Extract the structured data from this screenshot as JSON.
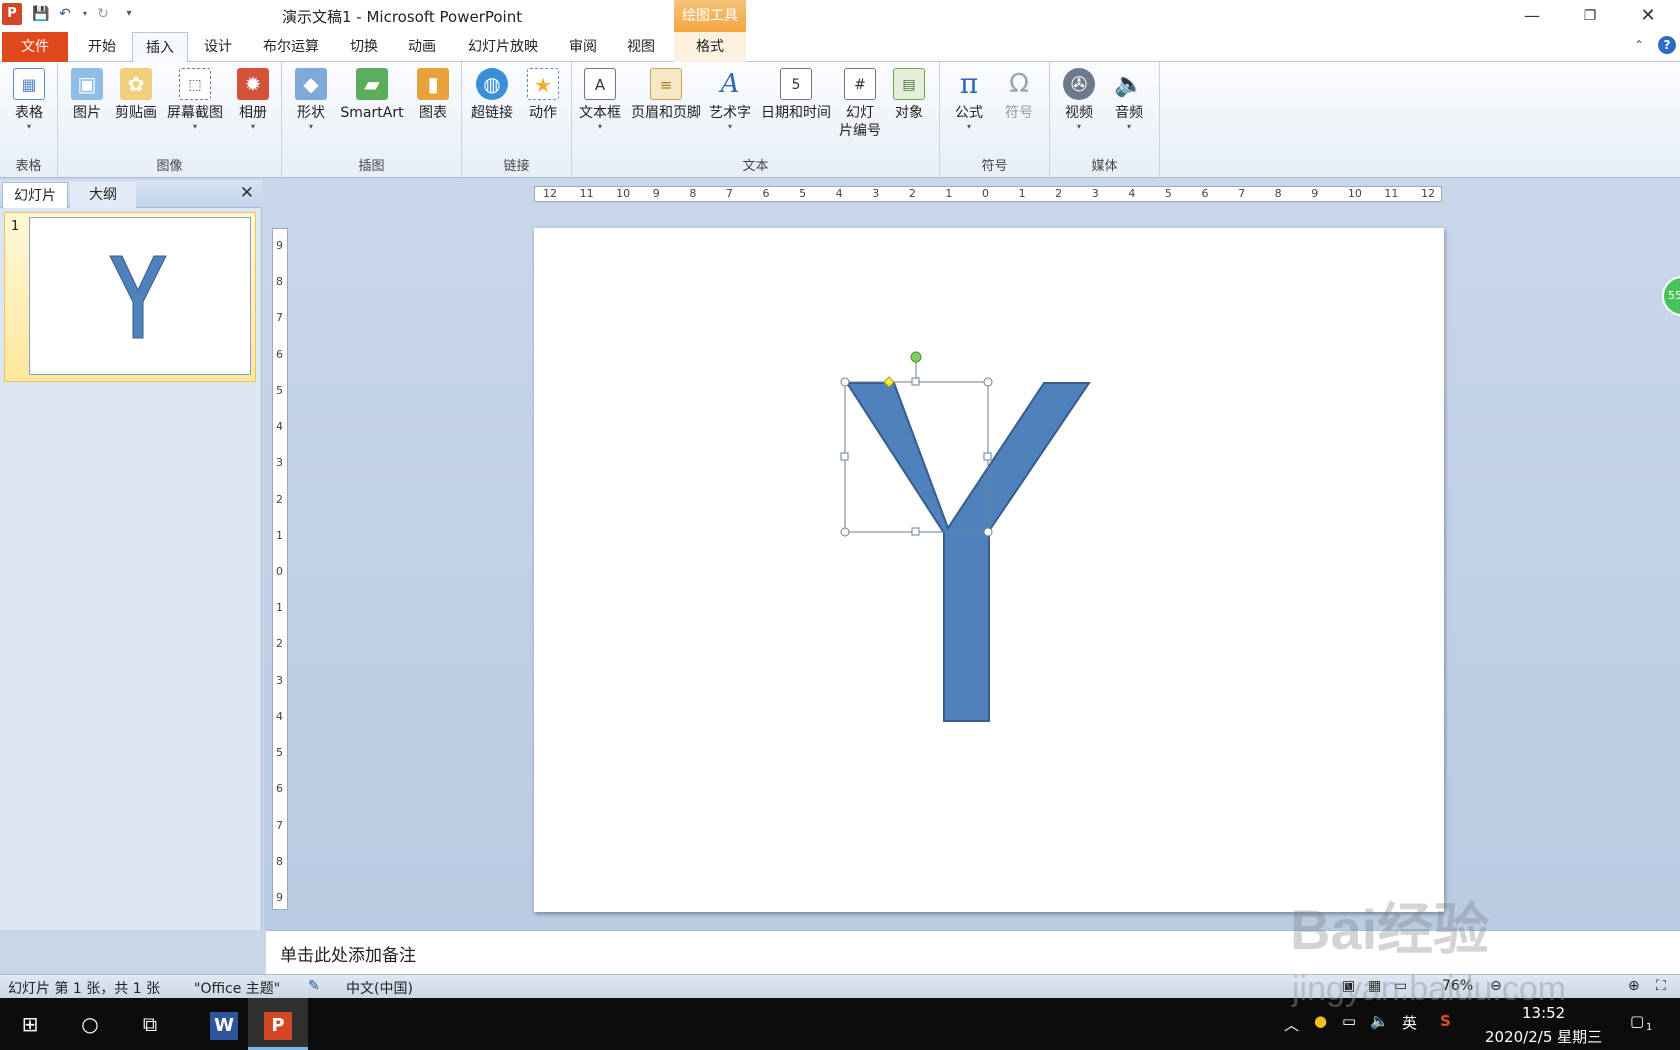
{
  "titlebar": {
    "app_icon": "P",
    "title": "演示文稿1 - Microsoft PowerPoint",
    "context_tool": "绘图工具",
    "qat": [
      "save-icon",
      "undo-icon",
      "redo-icon",
      "customize-icon"
    ]
  },
  "tabs": [
    "文件",
    "开始",
    "插入",
    "设计",
    "布尔运算",
    "切换",
    "动画",
    "幻灯片放映",
    "审阅",
    "视图",
    "格式"
  ],
  "ribbon": {
    "groups": [
      {
        "label": "表格",
        "buttons": [
          "表格"
        ]
      },
      {
        "label": "图像",
        "buttons": [
          "图片",
          "剪贴画",
          "屏幕截图",
          "相册"
        ]
      },
      {
        "label": "插图",
        "buttons": [
          "形状",
          "SmartArt",
          "图表"
        ]
      },
      {
        "label": "链接",
        "buttons": [
          "超链接",
          "动作"
        ]
      },
      {
        "label": "文本",
        "buttons": [
          "文本框",
          "页眉和页脚",
          "艺术字",
          "日期和时间",
          "幻灯片编号",
          "对象"
        ]
      },
      {
        "label": "符号",
        "buttons": [
          "公式",
          "符号"
        ]
      },
      {
        "label": "媒体",
        "buttons": [
          "视频",
          "音频"
        ]
      }
    ],
    "slide_number_line1": "幻灯",
    "slide_number_line2": "片编号"
  },
  "left_panel": {
    "tab_slides": "幻灯片",
    "tab_outline": "大纲",
    "thumb_number": "1",
    "thumb_letter": "Y"
  },
  "ruler": {
    "h_ticks": [
      "12",
      "11",
      "10",
      "9",
      "8",
      "7",
      "6",
      "5",
      "4",
      "3",
      "2",
      "1",
      "0",
      "1",
      "2",
      "3",
      "4",
      "5",
      "6",
      "7",
      "8",
      "9",
      "10",
      "11",
      "12"
    ],
    "v_ticks": [
      "9",
      "8",
      "7",
      "6",
      "5",
      "4",
      "3",
      "2",
      "1",
      "0",
      "1",
      "2",
      "3",
      "4",
      "5",
      "6",
      "7",
      "8",
      "9"
    ]
  },
  "badge": "55",
  "notes": {
    "placeholder": "单击此处添加备注"
  },
  "status": {
    "slide_info": "幻灯片 第 1 张，共 1 张",
    "theme": "\"Office 主题\"",
    "language": "中文(中国)",
    "zoom": "76%"
  },
  "taskbar": {
    "ime": "英",
    "time": "13:52",
    "date": "2020/2/5 星期三",
    "notification_count": "1"
  },
  "watermark": {
    "text": "Bai经验",
    "url": "jingyan.baidu.com"
  },
  "colors": {
    "accent": "#e0481e",
    "shape_fill": "#4f81bd",
    "shape_stroke": "#385d8a"
  }
}
